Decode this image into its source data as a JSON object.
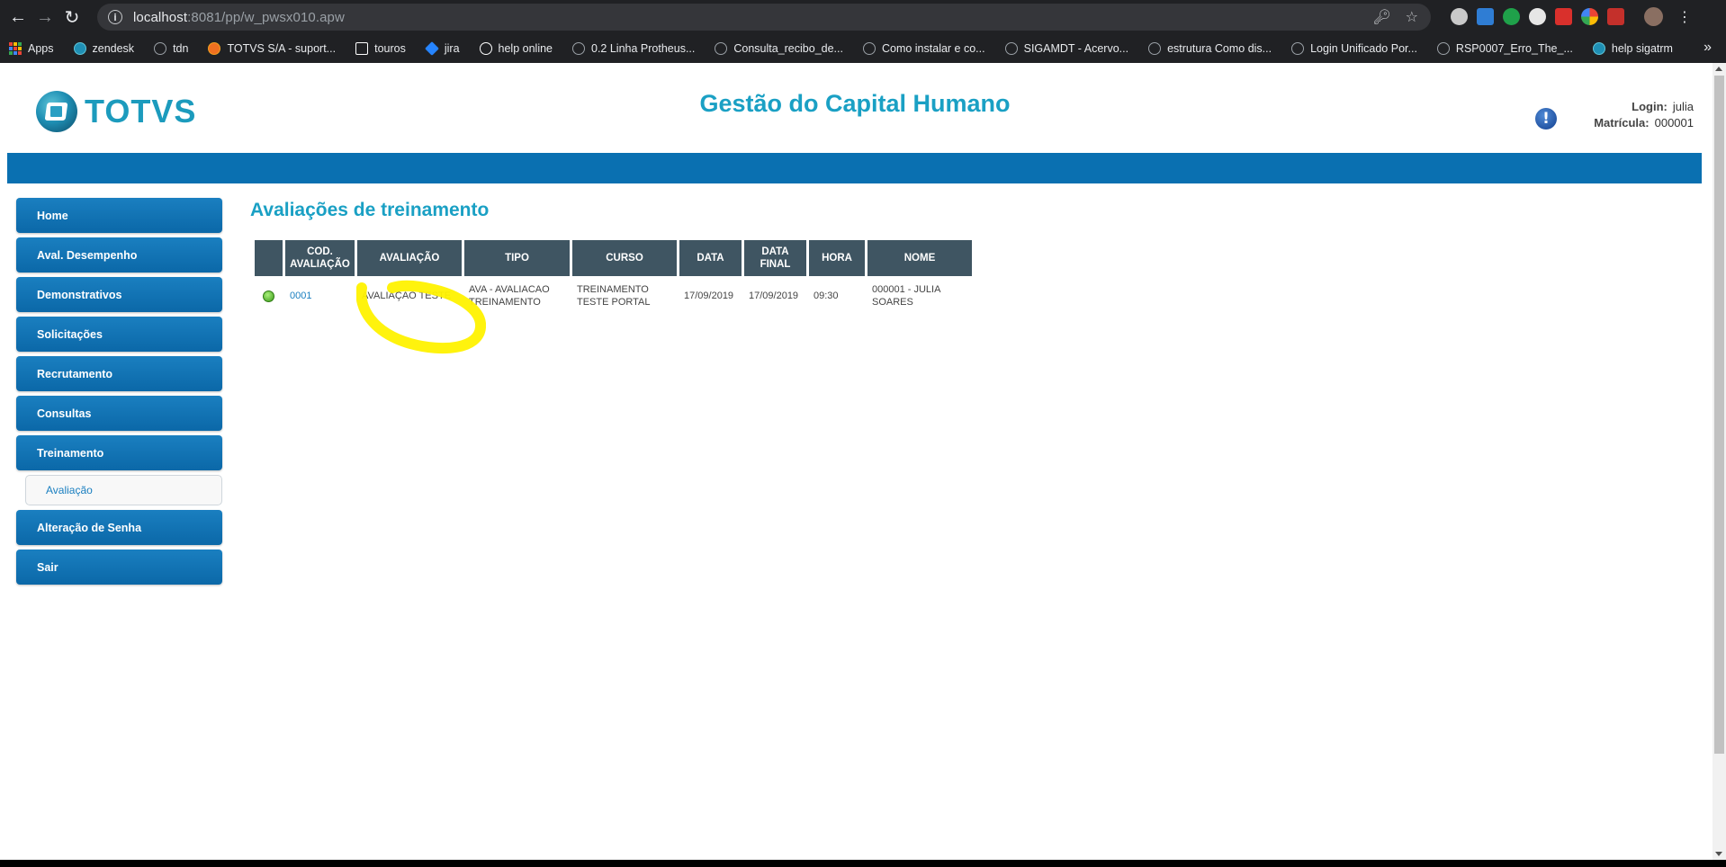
{
  "browser": {
    "url_host": "localhost",
    "url_path": ":8081/pp/w_pwsx010.apw",
    "bookmarks": [
      {
        "label": "Apps"
      },
      {
        "label": "zendesk"
      },
      {
        "label": "tdn"
      },
      {
        "label": "TOTVS S/A - suport..."
      },
      {
        "label": "touros"
      },
      {
        "label": "jira"
      },
      {
        "label": "help online"
      },
      {
        "label": "0.2 Linha Protheus..."
      },
      {
        "label": "Consulta_recibo_de..."
      },
      {
        "label": "Como instalar e co..."
      },
      {
        "label": "SIGAMDT - Acervo..."
      },
      {
        "label": "estrutura Como dis..."
      },
      {
        "label": "Login Unificado Por..."
      },
      {
        "label": "RSP0007_Erro_The_..."
      },
      {
        "label": "help sigatrm"
      }
    ],
    "more_label": "»"
  },
  "header": {
    "logo_text": "TOTVS",
    "app_title": "Gestão do Capital Humano",
    "login_label": "Login:",
    "login_value": "julia",
    "matricula_label": "Matrícula:",
    "matricula_value": "000001"
  },
  "sidebar": {
    "items": [
      {
        "label": "Home"
      },
      {
        "label": "Aval. Desempenho"
      },
      {
        "label": "Demonstrativos"
      },
      {
        "label": "Solicitações"
      },
      {
        "label": "Recrutamento"
      },
      {
        "label": "Consultas"
      },
      {
        "label": "Treinamento"
      },
      {
        "label": "Alteração de Senha"
      },
      {
        "label": "Sair"
      }
    ],
    "submenu_label": "Avaliação"
  },
  "main": {
    "title": "Avaliações de treinamento",
    "columns": [
      "",
      "COD. AVALIAÇÃO",
      "AVALIAÇÃO",
      "TIPO",
      "CURSO",
      "DATA",
      "DATA FINAL",
      "HORA",
      "NOME"
    ],
    "rows": [
      {
        "cod": "0001",
        "avaliacao": "AVALIAÇAO TESTE",
        "tipo": "AVA - AVALIACAO TREINAMENTO",
        "curso": "TREINAMENTO TESTE PORTAL",
        "data": "17/09/2019",
        "data_final": "17/09/2019",
        "hora": "09:30",
        "nome": "000001 - JULIA SOARES"
      }
    ]
  },
  "colors": {
    "accent": "#1aa0c4",
    "menu_blue": "#0b6fb0",
    "table_header": "#3f5562",
    "highlight": "#fff200"
  }
}
